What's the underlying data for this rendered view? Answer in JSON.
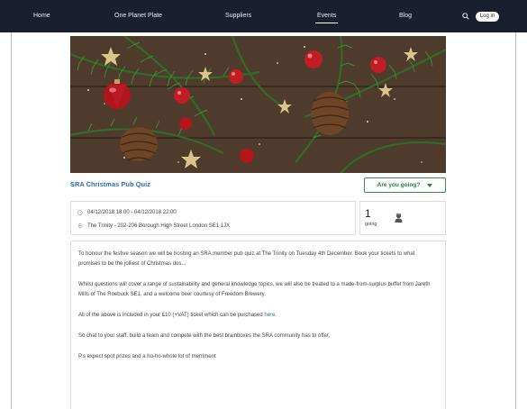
{
  "nav": {
    "items": [
      "Home",
      "One Planet Plate",
      "Suppliers",
      "Events",
      "Blog"
    ],
    "active": "Events",
    "search_icon": "search-icon",
    "login_label": "Log in"
  },
  "event": {
    "title": "SRA Christmas Pub Quiz",
    "going_label": "Are you going?",
    "datetime": "04/12/2018 18:00 - 04/12/2018 22:00",
    "location": "The Trinity - 202-206 Borough High Street London SE1 1JX",
    "going_count": "1",
    "going_text": "going"
  },
  "description": {
    "p1": "To honour the festive season we will be hosting an SRA member pub quiz at The Trinity on Tuesday 4th December. Book your tickets to what promises to be the jolliest of Christmas dos...",
    "p2": "Whilst questions will cover a range of sustainability and general knowledge topics, we will also be treated to a made-from-surplus buffet from Jareth Mills of The Roebuck SE1, and a welcome beer courtesy of Freedom Brewery.",
    "p3_text": "All of the above is included in your £10 (+VAT) ticket which can be purchased ",
    "p3_link": "here.",
    "p4": "So chat to your staff, build a team and compete with the best brainboxes the SRA community has to offer.",
    "p5": "P.s expect spot prizes and a ho-ho-whole lot of merriment"
  },
  "colors": {
    "nav_bg": "#1a1f2d",
    "title": "#2f6fb6",
    "going_button": "#3b8a4b"
  }
}
